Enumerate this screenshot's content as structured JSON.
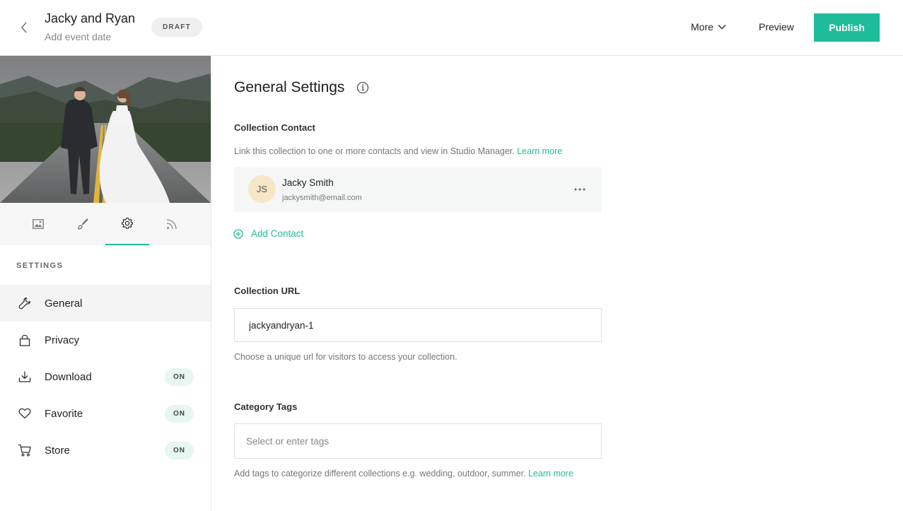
{
  "header": {
    "title": "Jacky and Ryan",
    "subtitle": "Add event date",
    "badge": "DRAFT",
    "more_label": "More",
    "preview_label": "Preview",
    "publish_label": "Publish"
  },
  "sidebar": {
    "tabs": [
      {
        "icon": "image-icon"
      },
      {
        "icon": "brush-icon"
      },
      {
        "icon": "gear-icon",
        "active": true
      },
      {
        "icon": "rss-icon"
      }
    ],
    "section_label": "SETTINGS",
    "items": [
      {
        "label": "General",
        "icon": "wrench-icon",
        "active": true
      },
      {
        "label": "Privacy",
        "icon": "lock-icon"
      },
      {
        "label": "Download",
        "icon": "download-icon",
        "badge": "ON"
      },
      {
        "label": "Favorite",
        "icon": "heart-icon",
        "badge": "ON"
      },
      {
        "label": "Store",
        "icon": "cart-icon",
        "badge": "ON"
      }
    ]
  },
  "main": {
    "title": "General Settings",
    "collection_contact": {
      "label": "Collection Contact",
      "help": "Link this collection to one or more contacts and view in Studio Manager.",
      "help_link": "Learn more",
      "contact": {
        "initials": "JS",
        "name": "Jacky Smith",
        "email": "jackysmith@email.com"
      },
      "add_label": "Add Contact"
    },
    "collection_url": {
      "label": "Collection URL",
      "value": "jackyandryan-1",
      "help": "Choose a unique url for visitors to access your collection."
    },
    "category_tags": {
      "label": "Category Tags",
      "placeholder": "Select or enter tags",
      "help": "Add tags to categorize different collections e.g. wedding, outdoor, summer.",
      "help_link": "Learn more"
    }
  },
  "colors": {
    "accent": "#1fbc9c",
    "on_badge_bg": "#e6f6f1",
    "avatar_bg": "#f6e7c6"
  }
}
